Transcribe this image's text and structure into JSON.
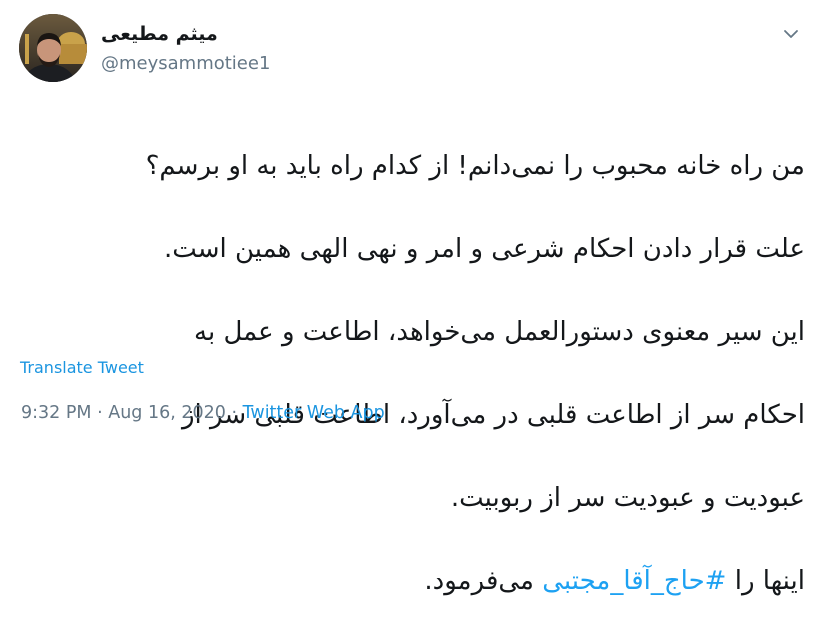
{
  "user": {
    "display_name": "میثم مطیعی",
    "handle": "@meysammotiee1",
    "avatar_icon": "profile-photo"
  },
  "menu": {
    "caret_icon": "chevron-down-icon"
  },
  "tweet": {
    "lines": [
      "من راه خانه محبوب را نمی‌دانم! از کدام راه باید به او برسم؟",
      "علت قرار دادن احکام شرعی و امر و نهی الهی همین است.",
      "این سیر معنوی دستورالعمل می‌خواهد، اطاعت و عمل به",
      "احکام سر از اطاعت قلبی در می‌آورد، اطاعت قلبی سر از",
      "عبودیت و عبودیت سر از ربوبیت."
    ],
    "last_line_prefix": "اینها را ",
    "hashtag": "#حاج_آقا_مجتبی",
    "last_line_suffix": " می‌فرمود."
  },
  "actions": {
    "translate_label": "Translate Tweet"
  },
  "meta": {
    "time": "9:32 PM",
    "separator": " · ",
    "date": "Aug 16, 2020",
    "source": "Twitter Web App"
  },
  "colors": {
    "text": "#14171a",
    "secondary": "#657786",
    "link": "#1b95e0",
    "hashtag": "#1da1f2"
  }
}
